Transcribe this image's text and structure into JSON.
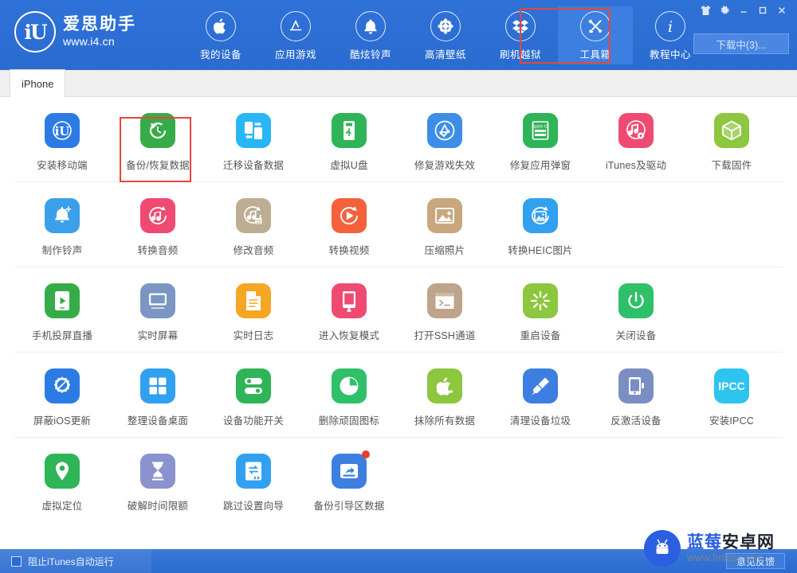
{
  "header": {
    "brand": {
      "mark": "iU",
      "name": "爱思助手",
      "url": "www.i4.cn"
    },
    "nav": [
      {
        "label": "我的设备",
        "icon": "apple-icon",
        "active": false
      },
      {
        "label": "应用游戏",
        "icon": "appstore-icon",
        "active": false
      },
      {
        "label": "酷炫铃声",
        "icon": "bell-icon",
        "active": false
      },
      {
        "label": "高清壁纸",
        "icon": "flower-icon",
        "active": false
      },
      {
        "label": "刷机越狱",
        "icon": "dropbox-icon",
        "active": false
      },
      {
        "label": "工具箱",
        "icon": "tools-icon",
        "active": true
      },
      {
        "label": "教程中心",
        "icon": "info-icon",
        "active": false
      }
    ],
    "window_buttons": [
      {
        "name": "skin-icon",
        "glyph": "skin"
      },
      {
        "name": "settings-icon",
        "glyph": "gear"
      },
      {
        "name": "minimize-icon",
        "glyph": "minimize"
      },
      {
        "name": "maximize-icon",
        "glyph": "maximize"
      },
      {
        "name": "close-icon",
        "glyph": "close"
      }
    ],
    "download_button": "下载中(3)..."
  },
  "tabs": [
    {
      "label": "iPhone",
      "active": true
    }
  ],
  "tool_rows": [
    [
      {
        "label": "安装移动端",
        "icon": "i4-app-icon",
        "color": "#2c7be5",
        "highlight": false
      },
      {
        "label": "备份/恢复数据",
        "icon": "backup-restore-icon",
        "color": "#35ac48",
        "highlight": true
      },
      {
        "label": "迁移设备数据",
        "icon": "migrate-device-icon",
        "color": "#29b6f6",
        "highlight": false
      },
      {
        "label": "虚拟U盘",
        "icon": "usb-drive-icon",
        "color": "#2fb457",
        "highlight": false
      },
      {
        "label": "修复游戏失效",
        "icon": "fix-game-icon",
        "color": "#3d8ee6",
        "highlight": false
      },
      {
        "label": "修复应用弹窗",
        "icon": "fix-appleid-popup-icon",
        "color": "#2fb457",
        "highlight": false
      },
      {
        "label": "iTunes及驱动",
        "icon": "itunes-driver-icon",
        "color": "#ef4b72",
        "highlight": false
      },
      {
        "label": "下载固件",
        "icon": "download-firmware-icon",
        "color": "#8dc63f",
        "highlight": false
      }
    ],
    [
      {
        "label": "制作铃声",
        "icon": "make-ringtone-icon",
        "color": "#3aa0ea",
        "highlight": false
      },
      {
        "label": "转换音频",
        "icon": "convert-audio-icon",
        "color": "#ef4b72",
        "highlight": false
      },
      {
        "label": "修改音频",
        "icon": "edit-audio-icon",
        "color": "#bdae93",
        "highlight": false
      },
      {
        "label": "转换视频",
        "icon": "convert-video-icon",
        "color": "#f4613c",
        "highlight": false
      },
      {
        "label": "压缩照片",
        "icon": "compress-photo-icon",
        "color": "#c8a77e",
        "highlight": false
      },
      {
        "label": "转换HEIC图片",
        "icon": "convert-heic-icon",
        "color": "#31a0f0",
        "highlight": false
      }
    ],
    [
      {
        "label": "手机投屏直播",
        "icon": "screen-cast-icon",
        "color": "#35ac48",
        "highlight": false
      },
      {
        "label": "实时屏幕",
        "icon": "realtime-screen-icon",
        "color": "#7b96c4",
        "highlight": false
      },
      {
        "label": "实时日志",
        "icon": "realtime-log-icon",
        "color": "#f5a623",
        "highlight": false
      },
      {
        "label": "进入恢复模式",
        "icon": "recovery-mode-icon",
        "color": "#ef4b72",
        "highlight": false
      },
      {
        "label": "打开SSH通道",
        "icon": "ssh-tunnel-icon",
        "color": "#bda48a",
        "highlight": false
      },
      {
        "label": "重启设备",
        "icon": "reboot-device-icon",
        "color": "#8dc63f",
        "highlight": false
      },
      {
        "label": "关闭设备",
        "icon": "power-off-icon",
        "color": "#2fc06a",
        "highlight": false
      }
    ],
    [
      {
        "label": "屏蔽iOS更新",
        "icon": "block-ios-update-icon",
        "color": "#2c7be5",
        "highlight": false
      },
      {
        "label": "整理设备桌面",
        "icon": "arrange-desktop-icon",
        "color": "#31a0f0",
        "highlight": false
      },
      {
        "label": "设备功能开关",
        "icon": "feature-switch-icon",
        "color": "#2fb457",
        "highlight": false
      },
      {
        "label": "删除顽固图标",
        "icon": "delete-stubborn-icon-icon",
        "color": "#2fc06a",
        "highlight": false
      },
      {
        "label": "抹除所有数据",
        "icon": "erase-all-data-icon",
        "color": "#8dc63f",
        "highlight": false
      },
      {
        "label": "清理设备垃圾",
        "icon": "clean-junk-icon",
        "color": "#3d7fe0",
        "highlight": false
      },
      {
        "label": "反激活设备",
        "icon": "deactivate-device-icon",
        "color": "#7b8ec4",
        "highlight": false
      },
      {
        "label": "安装IPCC",
        "icon": "install-ipcc-icon",
        "color": "#2ec4f0",
        "highlight": false,
        "text": "IPCC"
      }
    ],
    [
      {
        "label": "虚拟定位",
        "icon": "virtual-location-icon",
        "color": "#2fb457",
        "highlight": false
      },
      {
        "label": "破解时间限额",
        "icon": "crack-screen-time-icon",
        "color": "#8b93cf",
        "highlight": false
      },
      {
        "label": "跳过设置向导",
        "icon": "skip-setup-wizard-icon",
        "color": "#31a0f0",
        "highlight": false
      },
      {
        "label": "备份引导区数据",
        "icon": "backup-boot-data-icon",
        "color": "#3d7fe0",
        "highlight": false,
        "badge": true
      }
    ]
  ],
  "footer": {
    "checkbox_label": "阻止iTunes自动运行",
    "checkbox_checked": false,
    "feedback_button": "意见反馈"
  },
  "watermark": {
    "title_a": "蓝莓",
    "title_b": "安卓网",
    "url": "www.lmkjst.com"
  },
  "colors": {
    "header_blue": "#2b6fd6",
    "highlight_red": "#e8453c",
    "footer_blue": "#2a6bd0"
  }
}
